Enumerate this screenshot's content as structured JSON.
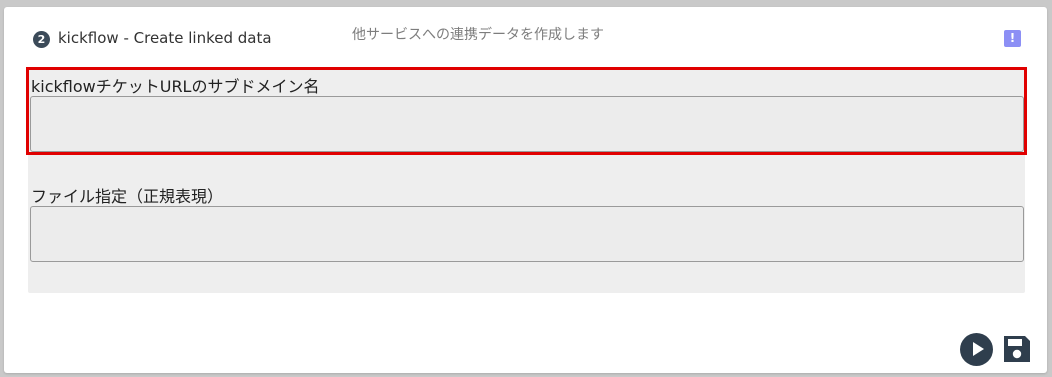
{
  "step": {
    "number": "2",
    "title": "kickflow - Create linked data",
    "subtitle": "他サービスへの連携データを作成します"
  },
  "header": {
    "warning_icon": "exclamation-icon",
    "warning_glyph": "!"
  },
  "form": {
    "fields": [
      {
        "label": "kickflowチケットURLのサブドメイン名",
        "value": ""
      },
      {
        "label": "ファイル指定（正規表現）",
        "value": ""
      }
    ]
  },
  "actions": {
    "run_icon": "play-icon",
    "save_icon": "floppy-disk-icon"
  },
  "colors": {
    "highlight": "#e00000",
    "accent_icon": "#8c8ff5",
    "dark_icon": "#2f3e4d"
  }
}
